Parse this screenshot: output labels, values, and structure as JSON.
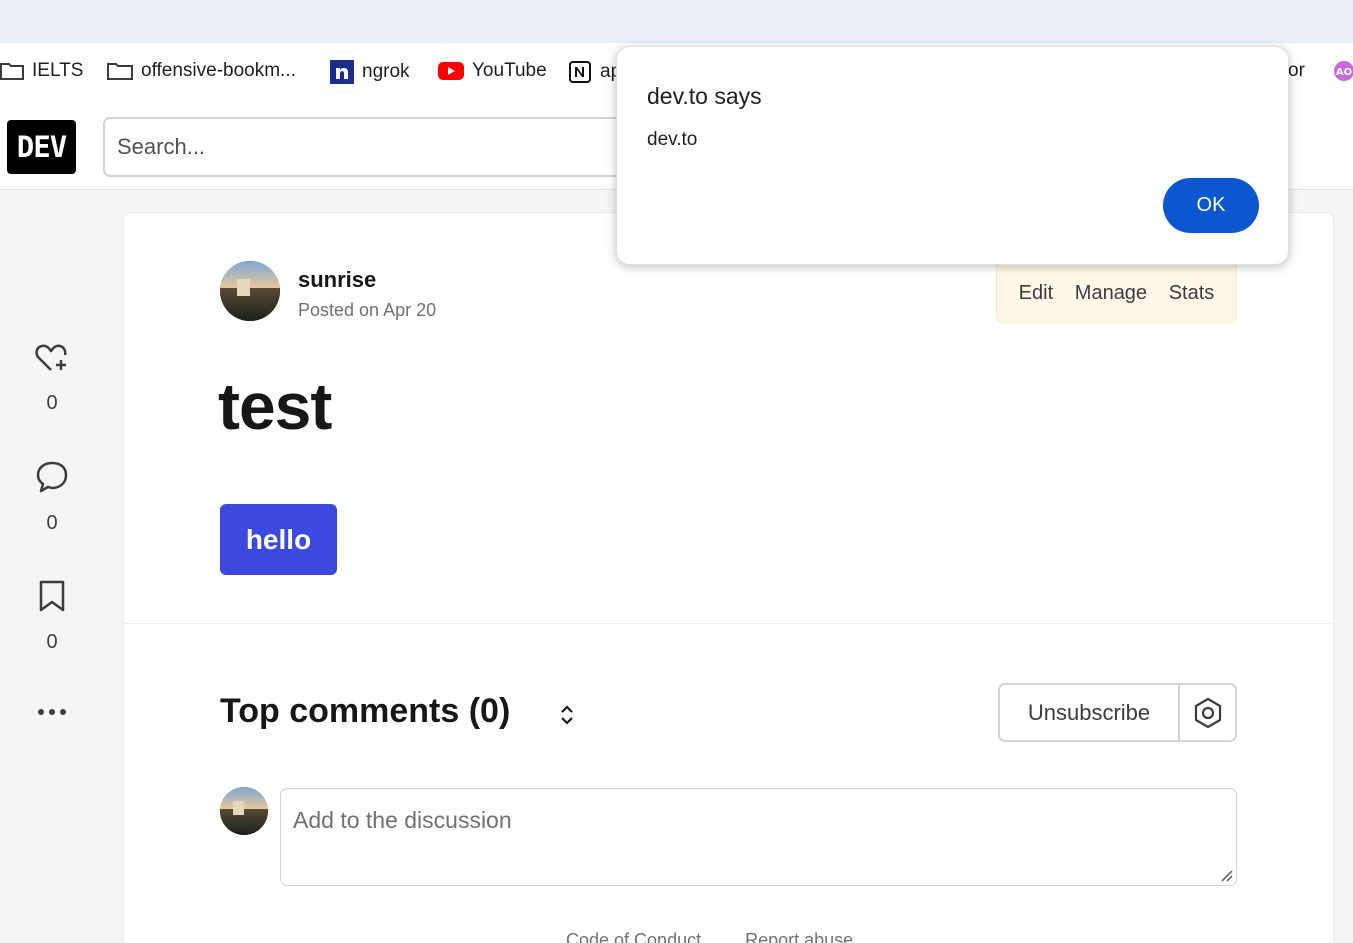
{
  "browser": {
    "bookmarks": [
      {
        "label": "IELTS",
        "icon": "folder-icon"
      },
      {
        "label": "offensive-bookm...",
        "icon": "folder-icon"
      },
      {
        "label": "ngrok",
        "icon": "ngrok-icon"
      },
      {
        "label": "YouTube",
        "icon": "youtube-icon"
      },
      {
        "label": "ap",
        "icon": "notion-icon"
      },
      {
        "label": "or",
        "icon": ""
      },
      {
        "label": "",
        "icon": "ao-icon"
      }
    ],
    "colors": {
      "youtube": "#ff0000",
      "ngrok": "#1a2c8c"
    }
  },
  "header": {
    "logo": "DEV",
    "search_placeholder": "Search..."
  },
  "sidebar": {
    "reactions_count": "0",
    "comments_count": "0",
    "bookmarks_count": "0"
  },
  "post": {
    "author": "sunrise",
    "posted": "Posted on Apr 20",
    "actions": {
      "edit": "Edit",
      "manage": "Manage",
      "stats": "Stats"
    },
    "title": "test",
    "body_button": "hello"
  },
  "comments": {
    "title": "Top comments (0)",
    "unsubscribe": "Unsubscribe",
    "placeholder": "Add to the discussion"
  },
  "footer": {
    "code_of_conduct": "Code of Conduct",
    "report_abuse": "Report abuse"
  },
  "dialog": {
    "title": "dev.to says",
    "message": "dev.to",
    "ok": "OK"
  },
  "colors": {
    "accent": "#3b49df",
    "dialog_button": "#0b57d0",
    "actions_bg": "#fff7e9"
  }
}
